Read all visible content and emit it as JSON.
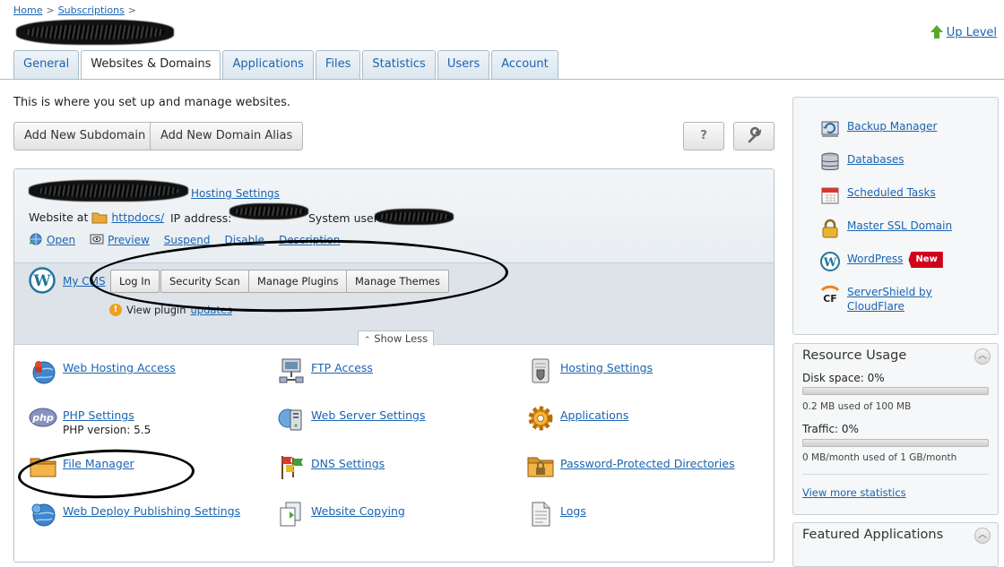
{
  "breadcrumb": {
    "home": "Home",
    "sep": ">",
    "current": "Subscriptions"
  },
  "up_level": "Up Level",
  "tabs": [
    "General",
    "Websites & Domains",
    "Applications",
    "Files",
    "Statistics",
    "Users",
    "Account"
  ],
  "active_tab": "Websites & Domains",
  "intro": "This is where you set up and manage websites.",
  "buttons": {
    "add_subdomain": "Add New Subdomain",
    "add_alias": "Add New Domain Alias",
    "help": "?"
  },
  "domain": {
    "hosting_settings": "Hosting Settings",
    "website_at": "Website at",
    "httpdocs": "httpdocs/",
    "ip_label": "IP address:",
    "system_user_label": "System user:",
    "actions": [
      "Open",
      "Preview",
      "Suspend",
      "Disable",
      "Description"
    ]
  },
  "wordpress": {
    "my_cms": "My CMS",
    "buttons": [
      "Log In",
      "Security Scan",
      "Manage Plugins",
      "Manage Themes"
    ],
    "notice_prefix": "View plugin",
    "notice_link": "updates",
    "show_less": "Show Less"
  },
  "features": [
    {
      "label": "Web Hosting Access",
      "icon": "globe-user-icon"
    },
    {
      "label": "FTP Access",
      "icon": "ftp-icon"
    },
    {
      "label": "Hosting Settings",
      "icon": "scroll-icon"
    },
    {
      "label": "PHP Settings",
      "icon": "php-icon",
      "sub": "PHP version: 5.5"
    },
    {
      "label": "Web Server Settings",
      "icon": "server-icon"
    },
    {
      "label": "Applications",
      "icon": "gear-icon"
    },
    {
      "label": "File Manager",
      "icon": "folder-icon"
    },
    {
      "label": "DNS Settings",
      "icon": "flags-icon"
    },
    {
      "label": "Password-Protected Directories",
      "icon": "locked-folder-icon"
    },
    {
      "label": "Web Deploy Publishing Settings",
      "icon": "globe-deploy-icon"
    },
    {
      "label": "Website Copying",
      "icon": "copy-icon"
    },
    {
      "label": "Logs",
      "icon": "document-icon"
    }
  ],
  "sidebar_tools": [
    {
      "label": "Backup Manager",
      "icon": "backup-icon"
    },
    {
      "label": "Databases",
      "icon": "database-icon"
    },
    {
      "label": "Scheduled Tasks",
      "icon": "calendar-icon"
    },
    {
      "label": "Master SSL Domain",
      "icon": "lock-icon"
    },
    {
      "label": "WordPress",
      "icon": "wordpress-icon",
      "badge": "New"
    },
    {
      "label": "ServerShield by CloudFlare",
      "icon": "cloudflare-icon"
    }
  ],
  "resource_usage": {
    "title": "Resource Usage",
    "disk_label": "Disk space: 0%",
    "disk_detail": "0.2 MB used of 100 MB",
    "disk_fraction": 0,
    "traffic_label": "Traffic: 0%",
    "traffic_detail": "0 MB/month used of 1 GB/month",
    "traffic_fraction": 0,
    "more": "View more statistics"
  },
  "featured_apps": {
    "title": "Featured Applications"
  },
  "colors": {
    "link": "#1b64b0",
    "tab_border": "#a9bccb",
    "badge": "#d0021b"
  }
}
